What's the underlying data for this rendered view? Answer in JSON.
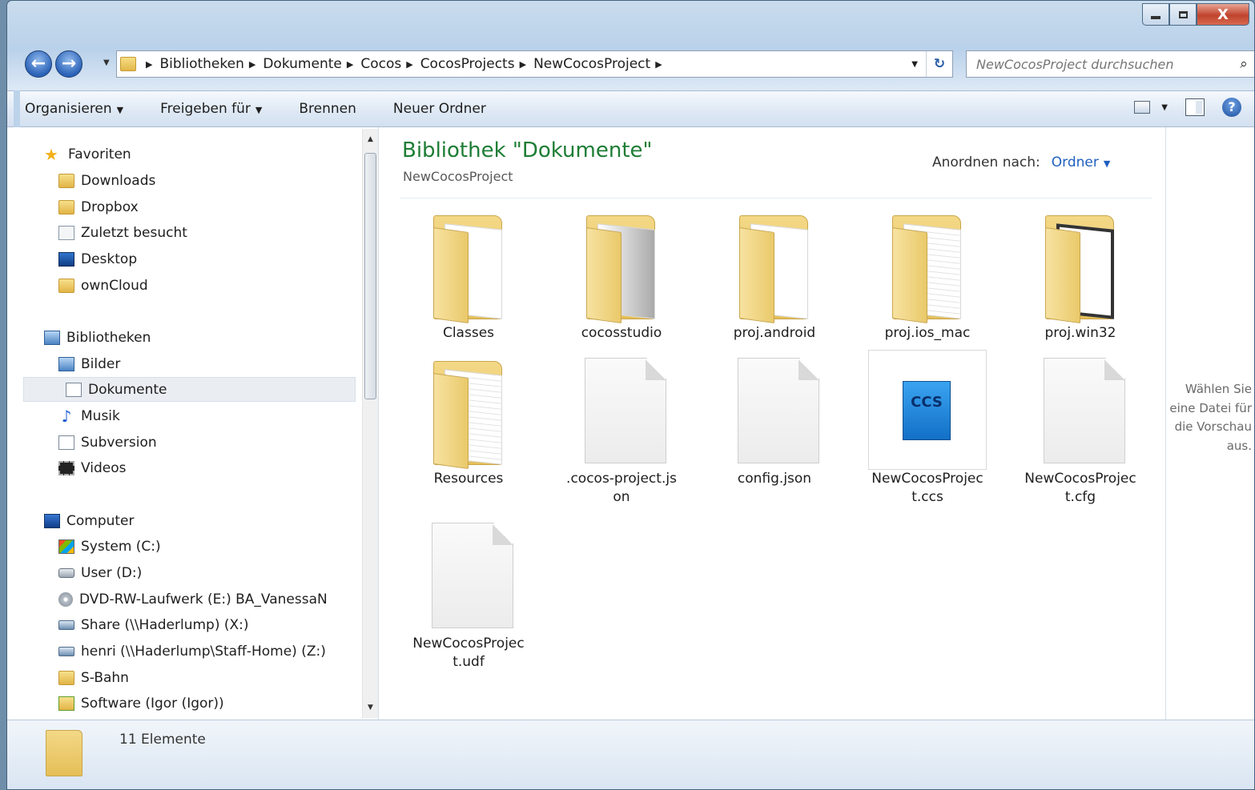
{
  "window": {
    "caption_buttons": {
      "minimize_icon": "minimize-icon",
      "maximize_icon": "maximize-icon",
      "close_label": "X"
    }
  },
  "address": {
    "breadcrumbs": [
      "Bibliotheken",
      "Dokumente",
      "Cocos",
      "CocosProjects",
      "NewCocosProject"
    ],
    "search_placeholder": "NewCocosProject durchsuchen"
  },
  "toolbar": {
    "organize": "Organisieren",
    "share": "Freigeben für",
    "burn": "Brennen",
    "new_folder": "Neuer Ordner",
    "help": "?"
  },
  "nav": {
    "favorites_label": "Favoriten",
    "favorites": [
      "Downloads",
      "Dropbox",
      "Zuletzt besucht",
      "Desktop",
      "ownCloud"
    ],
    "libraries_label": "Bibliotheken",
    "libraries": [
      "Bilder",
      "Dokumente",
      "Musik",
      "Subversion",
      "Videos"
    ],
    "computer_label": "Computer",
    "computer": [
      "System (C:)",
      "User (D:)",
      "DVD-RW-Laufwerk (E:) BA_VanessaN",
      "Share (\\\\Haderlump) (X:)",
      "henri (\\\\Haderlump\\Staff-Home) (Z:)",
      "S-Bahn",
      "Software (Igor (Igor))"
    ],
    "selected": "Dokumente"
  },
  "content": {
    "title": "Bibliothek \"Dokumente\"",
    "subtitle": "NewCocosProject",
    "arrange_label": "Anordnen nach:",
    "arrange_value": "Ordner",
    "items": [
      {
        "name": "Classes",
        "type": "folder"
      },
      {
        "name": "cocosstudio",
        "type": "folder"
      },
      {
        "name": "proj.android",
        "type": "folder"
      },
      {
        "name": "proj.ios_mac",
        "type": "folder"
      },
      {
        "name": "proj.win32",
        "type": "folder"
      },
      {
        "name": "Resources",
        "type": "folder"
      },
      {
        "name": ".cocos-project.js\non",
        "type": "file"
      },
      {
        "name": "config.json",
        "type": "file"
      },
      {
        "name": "NewCocosProjec\nt.ccs",
        "type": "ccs",
        "icon_text": "CCS"
      },
      {
        "name": "NewCocosProjec\nt.cfg",
        "type": "file"
      },
      {
        "name": "NewCocosProjec\nt.udf",
        "type": "file"
      }
    ]
  },
  "preview": {
    "message": "Wählen Sie eine Datei für die Vorschau aus."
  },
  "details": {
    "count": "11 Elemente"
  }
}
